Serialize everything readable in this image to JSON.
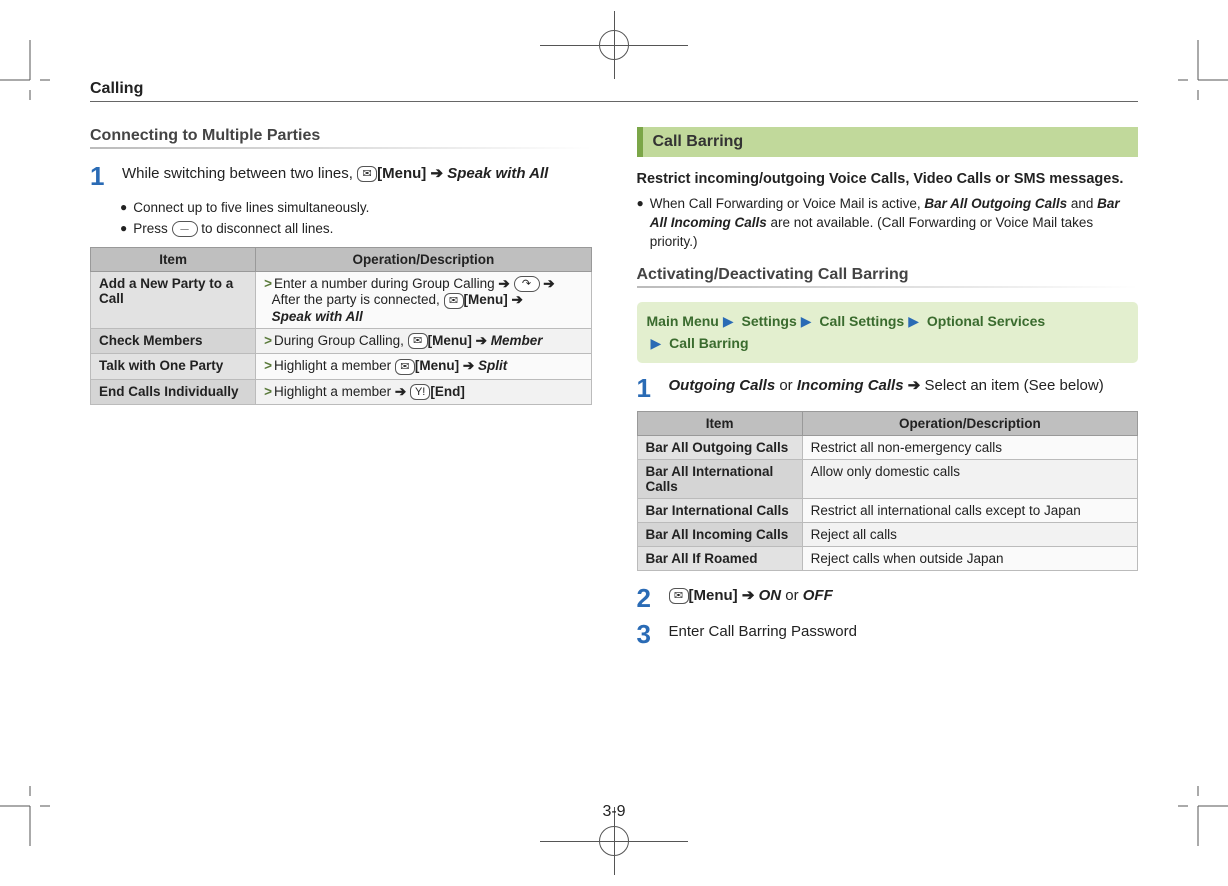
{
  "chapter": "Calling",
  "pagenum": "3-9",
  "left": {
    "heading": "Connecting to Multiple Parties",
    "step1_a": "While switching between two lines, ",
    "step1_menu": "[Menu]",
    "step1_b": "Speak with All",
    "bullets": [
      "Connect up to five lines simultaneously.",
      "Press        to disconnect all lines."
    ],
    "table": {
      "head": [
        "Item",
        "Operation/Description"
      ],
      "rows": [
        {
          "item": "Add a New Party to a Call",
          "op_a": "Enter a number during Group Calling ",
          "op_b": "After the party is connected, ",
          "op_menuLabel": "[Menu]",
          "op_c": "Speak with All"
        },
        {
          "item": "Check Members",
          "op_a": "During Group Calling, ",
          "op_menuLabel": "[Menu]",
          "op_c": "Member"
        },
        {
          "item": "Talk with One Party",
          "op_a": "Highlight a member ",
          "op_menuLabel": "[Menu]",
          "op_c": "Split"
        },
        {
          "item": "End Calls Individually",
          "op_a": "Highlight a member ",
          "op_endLabel": "[End]"
        }
      ]
    }
  },
  "right": {
    "sectionTitle": "Call Barring",
    "desc": "Restrict incoming/outgoing Voice Calls, Video Calls or SMS messages.",
    "note_a": "When Call Forwarding or Voice Mail is active, ",
    "note_b1": "Bar All Outgoing Calls",
    "note_mid": " and ",
    "note_b2": "Bar All Incoming Calls",
    "note_c": " are not available. (Call Forwarding or Voice Mail takes priority.)",
    "heading2": "Activating/Deactivating Call Barring",
    "menupath": [
      "Main Menu",
      "Settings",
      "Call Settings",
      "Optional Services",
      "Call Barring"
    ],
    "step1_a1": "Outgoing Calls",
    "step1_or": " or ",
    "step1_a2": "Incoming Calls",
    "step1_b": " Select an item (See below)",
    "table": {
      "head": [
        "Item",
        "Operation/Description"
      ],
      "rows": [
        {
          "item": "Bar All Outgoing Calls",
          "op": "Restrict all non-emergency calls"
        },
        {
          "item": "Bar All International Calls",
          "op": "Allow only domestic calls"
        },
        {
          "item": "Bar International Calls",
          "op": "Restrict all international calls except to Japan"
        },
        {
          "item": "Bar All Incoming Calls",
          "op": "Reject all calls"
        },
        {
          "item": "Bar All If Roamed",
          "op": "Reject calls when outside Japan"
        }
      ]
    },
    "step2_menu": "[Menu]",
    "step2_on": "ON",
    "step2_or": " or ",
    "step2_off": "OFF",
    "step3": "Enter Call Barring Password"
  }
}
